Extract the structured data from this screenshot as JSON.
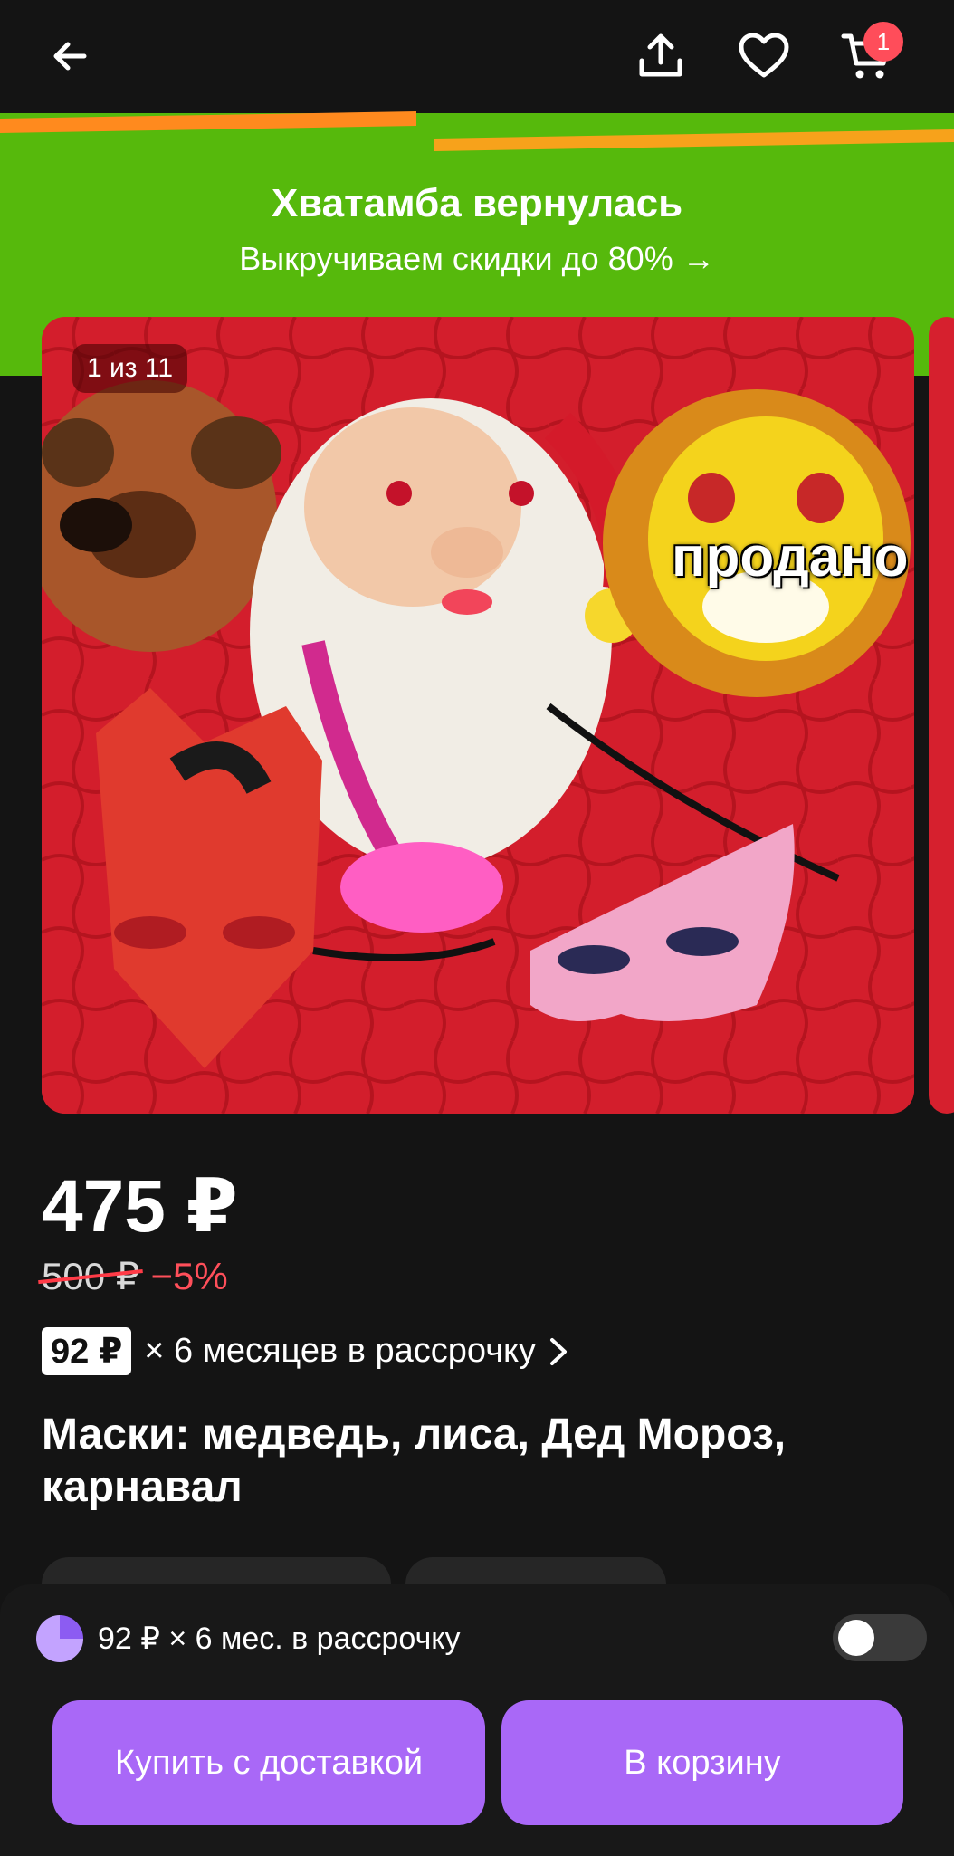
{
  "header": {
    "cart_count": "1"
  },
  "banner": {
    "title": "Хватамба вернулась",
    "subtitle": "Выкручиваем скидки до 80% →"
  },
  "gallery": {
    "counter": "1 из 11",
    "sold_overlay": "продано"
  },
  "product": {
    "price": "475 ₽",
    "old_price": "500 ₽",
    "discount": "−5%",
    "installment_amount": "92 ₽",
    "installment_text": "× 6 месяцев в рассрочку",
    "title": "Маски: медведь, лиса, Дед Мороз, карнавал"
  },
  "bottom_sheet": {
    "installment_summary": "92 ₽ × 6 мес. в рассрочку",
    "buy_label": "Купить с доставкой",
    "cart_label": "В корзину"
  },
  "colors": {
    "background": "#141414",
    "banner_green": "#56b90c",
    "accent_purple": "#a968f7",
    "discount_red": "#ff4f5a"
  }
}
